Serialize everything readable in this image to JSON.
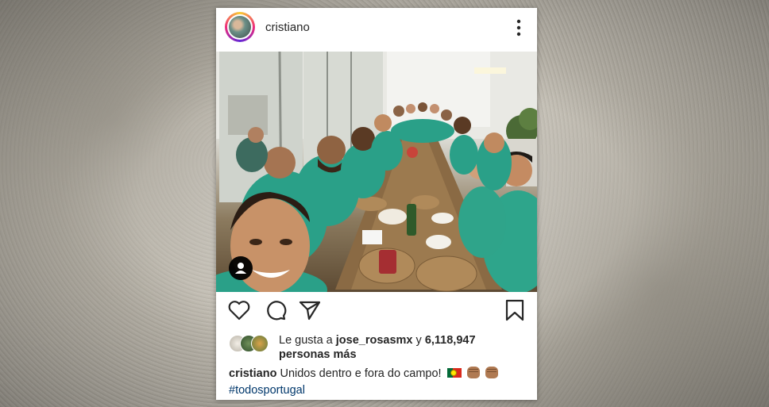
{
  "post": {
    "username": "cristiano",
    "likes": {
      "prefix": "Le gusta a",
      "user": "jose_rosasmx",
      "connector": "y",
      "count": "6,118,947",
      "suffix": "personas más"
    },
    "caption": {
      "username": "cristiano",
      "text": "Unidos dentro e fora do campo!",
      "emojis": [
        "portugal-flag",
        "fist-bump-left",
        "fist-bump-right"
      ],
      "hashtag": "#todosportugal"
    }
  },
  "colors": {
    "text": "#262626",
    "hashtag": "#00376b",
    "story_ring": [
      "#f9ce34",
      "#ee2a7b",
      "#6228d7"
    ],
    "jersey": "#2ea58b"
  },
  "icons": [
    "more-icon",
    "tag-people-icon",
    "heart-icon",
    "comment-icon",
    "share-icon",
    "bookmark-icon"
  ]
}
